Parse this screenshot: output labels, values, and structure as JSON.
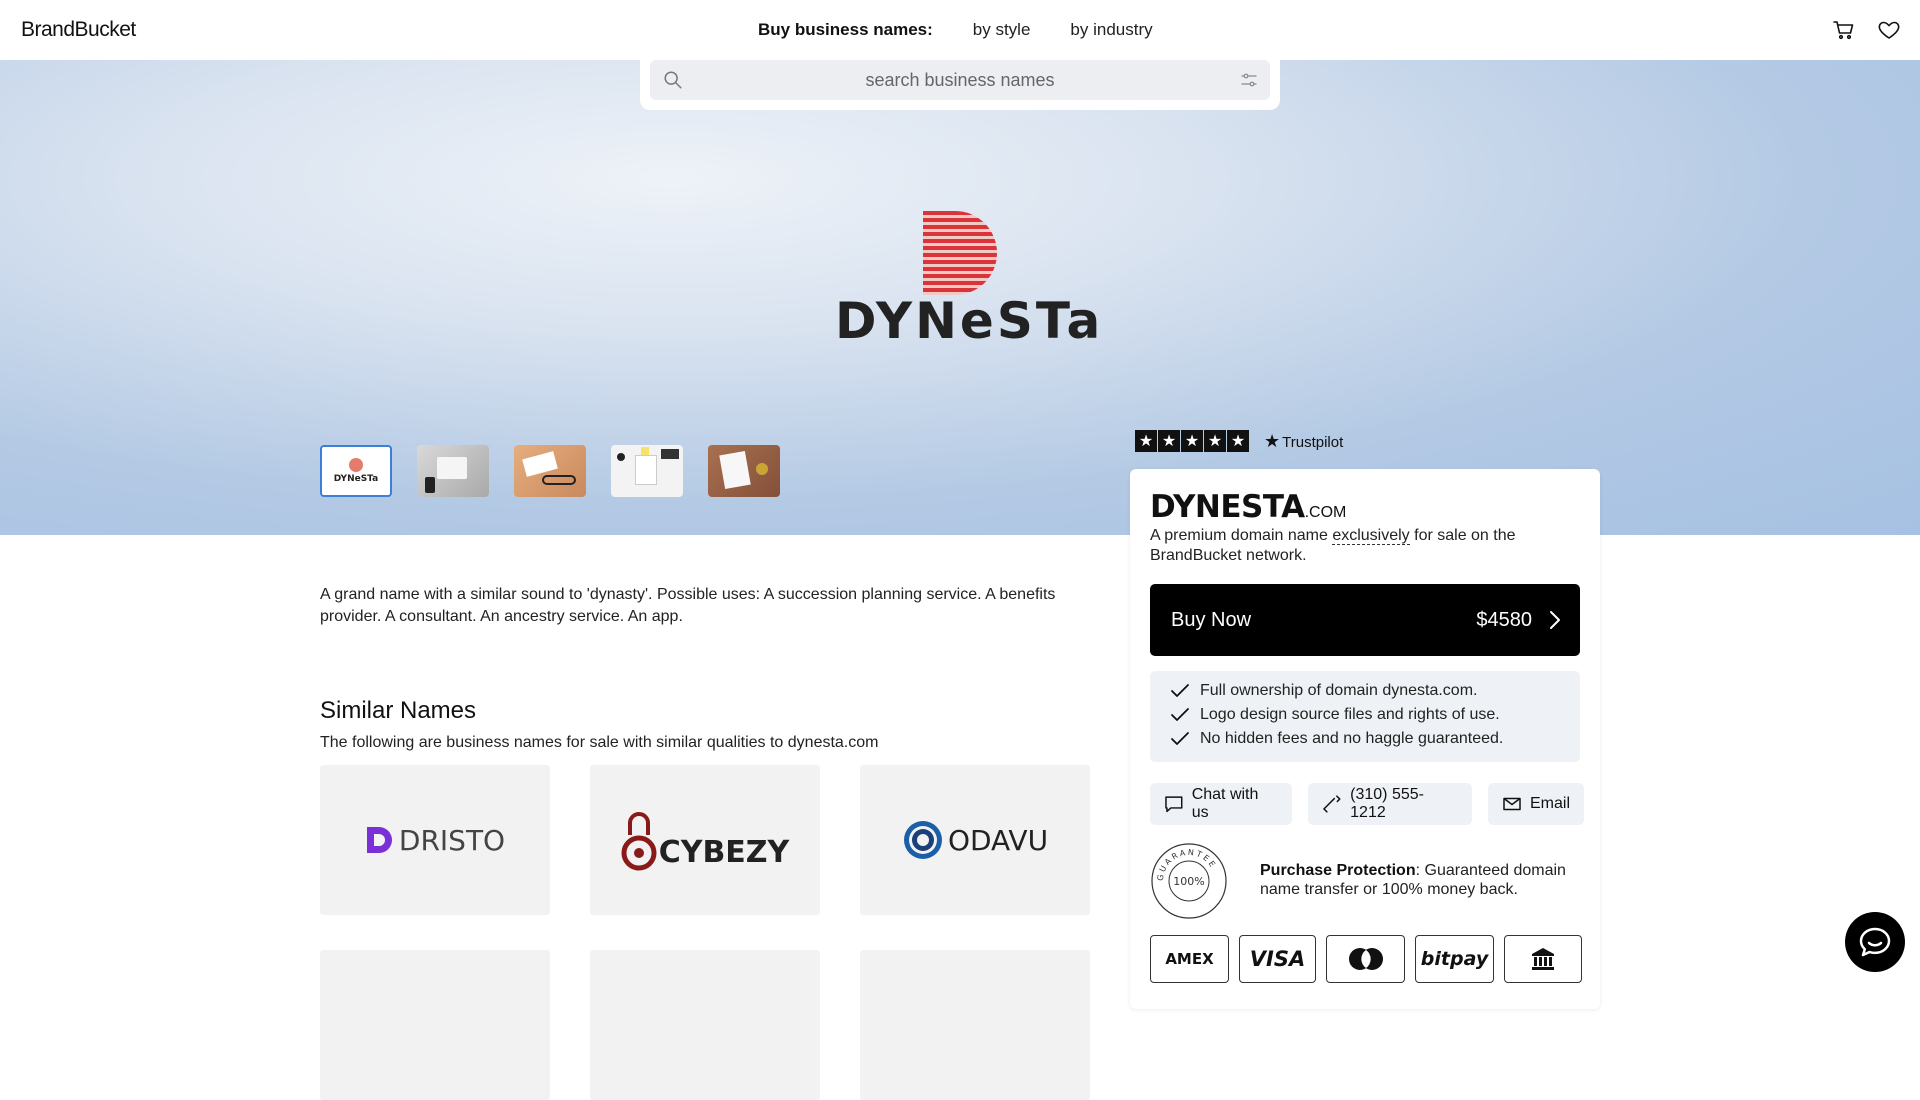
{
  "header": {
    "logo": "BrandBucket",
    "nav_title": "Buy business names:",
    "nav_links": [
      "by style",
      "by industry"
    ],
    "icons": [
      "cart-icon",
      "heart-icon"
    ]
  },
  "search": {
    "placeholder": "search business names"
  },
  "hero": {
    "brand_word": "DYNeSTa",
    "thumbnails": [
      {
        "label": "DYNeSTa",
        "active": true,
        "colors": [
          "#ffffff"
        ]
      },
      {
        "label": "",
        "active": false,
        "colors": [
          "#c9c9c9",
          "#9a9a9a"
        ]
      },
      {
        "label": "",
        "active": false,
        "colors": [
          "#e0a77a",
          "#c8875a"
        ]
      },
      {
        "label": "",
        "active": false,
        "colors": [
          "#f2f2f2",
          "#dddddd"
        ]
      },
      {
        "label": "",
        "active": false,
        "colors": [
          "#a66a4a",
          "#8a5238"
        ]
      }
    ],
    "trustpilot_label": "Trustpilot",
    "trustpilot_stars": 5
  },
  "card": {
    "name": "DYNESTA",
    "tld": ".COM",
    "desc_before": "A premium domain name ",
    "desc_emphasis": "exclusively",
    "desc_after": " for sale on the BrandBucket network.",
    "buy_label": "Buy Now",
    "price": "$4580",
    "features": [
      "Full ownership of domain dynesta.com.",
      "Logo design source files and rights of use.",
      "No hidden fees and no haggle guaranteed."
    ],
    "contacts": {
      "chat": "Chat with us",
      "phone": "(310) 555-1212",
      "email": "Email"
    },
    "guarantee": {
      "center": "100%",
      "ring": "GUARANTEE"
    },
    "protection_title": "Purchase Protection",
    "protection_text": ": Guaranteed domain name transfer or 100% money back.",
    "payments": [
      "AMEX",
      "VISA",
      "mastercard",
      "bitpay",
      "bank"
    ]
  },
  "main": {
    "description": "A grand name with a similar sound to 'dynasty'. Possible uses: A succession planning service. A benefits provider. A consultant. An ancestry service. An app.",
    "similar_title": "Similar Names",
    "similar_sub": "The following are business names for sale with similar qualities to dynesta.com",
    "similar": [
      {
        "name": "DRISTO",
        "color": "#7b2fd6"
      },
      {
        "name": "CYBEZY",
        "color": "#8a1a1a"
      },
      {
        "name": "ODAVU",
        "color": "#1a5fa8"
      }
    ]
  },
  "colors": {
    "accent": "#3c7fd8",
    "brand_red": "#d9343a",
    "dark": "#111111"
  }
}
